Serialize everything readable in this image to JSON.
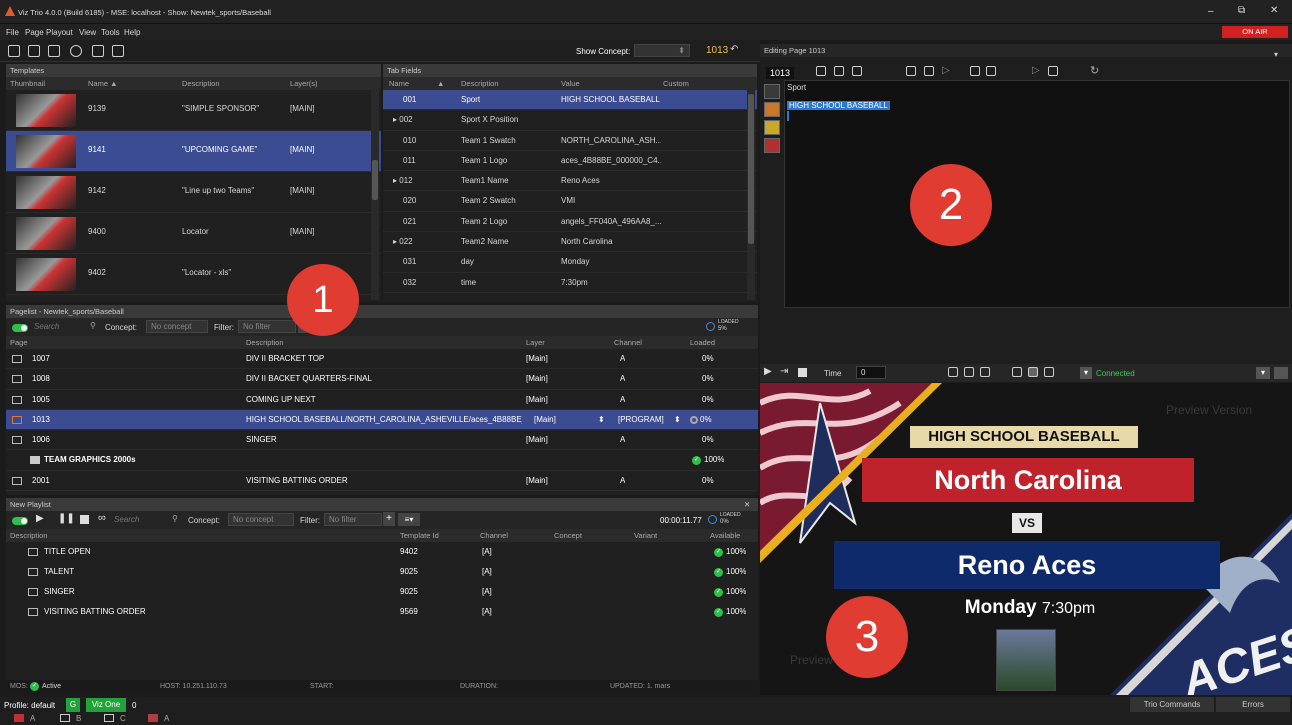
{
  "window": {
    "title": "Viz Trio 4.0.0 (Build 6185) - MSE: localhost - Show: Newtek_sports/Baseball",
    "minimize": "–",
    "restore": "⧉",
    "close": "✕",
    "on_air": "ON AIR"
  },
  "menu": [
    "File",
    "Page",
    "Playout",
    "View",
    "Tools",
    "Help"
  ],
  "toolbar": {
    "show_concept_label": "Show Concept:",
    "page_number": "1013",
    "concept_arrow": "⬍"
  },
  "templates": {
    "header": "Templates",
    "columns": [
      "Thumbnail",
      "Name ▲",
      "Description",
      "Layer(s)"
    ],
    "rows": [
      {
        "name": "9139",
        "description": "\"SIMPLE SPONSOR\"",
        "layer": "[MAIN]"
      },
      {
        "name": "9141",
        "description": "\"UPCOMING GAME\"",
        "layer": "[MAIN]"
      },
      {
        "name": "9142",
        "description": "\"Line up two Teams\"",
        "layer": "[MAIN]"
      },
      {
        "name": "9400",
        "description": "Locator",
        "layer": "[MAIN]"
      },
      {
        "name": "9402",
        "description": "\"Locator - xls\"",
        "layer": ""
      }
    ]
  },
  "tab_fields": {
    "header": "Tab Fields",
    "columns": [
      "Name",
      "▲",
      "Description",
      "Value",
      "Custom"
    ],
    "rows": [
      {
        "name": "001",
        "description": "Sport",
        "value": "HIGH SCHOOL BASEBALL"
      },
      {
        "name": "▸ 002",
        "description": "Sport X Position",
        "value": ""
      },
      {
        "name": "010",
        "description": "Team 1 Swatch",
        "value": "NORTH_CAROLINA_ASH..."
      },
      {
        "name": "011",
        "description": "Team 1 Logo",
        "value": "aces_4B88BE_000000_C4..."
      },
      {
        "name": "▸ 012",
        "description": "Team1 Name",
        "value": "Reno Aces"
      },
      {
        "name": "020",
        "description": "Team 2 Swatch",
        "value": "VMI"
      },
      {
        "name": "021",
        "description": "Team 2 Logo",
        "value": "angels_FF040A_496AA8_..."
      },
      {
        "name": "▸ 022",
        "description": "Team2 Name",
        "value": "North Carolina"
      },
      {
        "name": "031",
        "description": "day",
        "value": "Monday"
      },
      {
        "name": "032",
        "description": "time",
        "value": "7:30pm"
      }
    ]
  },
  "editing": {
    "header": "Editing Page 1013",
    "page_number": "1013",
    "field_label": "Sport",
    "field_value": "HIGH SCHOOL BASEBALL",
    "side_icons": [
      "ABC",
      "TXT",
      "IMG",
      "CLR"
    ]
  },
  "pagelist": {
    "header": "Pagelist - Newtek_sports/Baseball",
    "search_placeholder": "Search",
    "concept_label": "Concept:",
    "concept_value": "No concept",
    "filter_label": "Filter:",
    "filter_value": "No filter",
    "add": "+",
    "loaded_badge": "LOADED",
    "loaded_pct": "5%",
    "columns": [
      "Page",
      "Description",
      "Layer",
      "Channel",
      "Loaded"
    ],
    "rows": [
      {
        "page": "1007",
        "description": "DIV II BRACKET TOP",
        "layer": "[Main]",
        "channel": "A",
        "loaded": "0%",
        "folder": false
      },
      {
        "page": "1008",
        "description": "DIV II BACKET QUARTERS-FINAL",
        "layer": "[Main]",
        "channel": "A",
        "loaded": "0%",
        "folder": false
      },
      {
        "page": "1005",
        "description": "COMING UP NEXT",
        "layer": "[Main]",
        "channel": "A",
        "loaded": "0%",
        "folder": false
      },
      {
        "page": "1013",
        "description": "HIGH SCHOOL BASEBALL/NORTH_CAROLINA_ASHEVILLE/aces_4B88BE_...",
        "layer": "[Main]",
        "channel": "[PROGRAM]",
        "loaded": "0%",
        "folder": false
      },
      {
        "page": "1006",
        "description": "SINGER",
        "layer": "[Main]",
        "channel": "A",
        "loaded": "0%",
        "folder": false
      },
      {
        "page": "TEAM GRAPHICS 2000s",
        "description": "",
        "layer": "",
        "channel": "",
        "loaded": "100%",
        "folder": true
      },
      {
        "page": "2001",
        "description": "VISITING BATTING ORDER",
        "layer": "[Main]",
        "channel": "A",
        "loaded": "0%",
        "folder": false
      }
    ]
  },
  "playlist": {
    "header": "New Playlist",
    "close": "✕",
    "search_placeholder": "Search",
    "concept_label": "Concept:",
    "concept_value": "No concept",
    "filter_label": "Filter:",
    "filter_value": "No filter",
    "timer": "00:00:11.77",
    "loaded_badge": "LOADED",
    "loaded_pct": "0%",
    "columns": [
      "Description",
      "Template Id",
      "Channel",
      "Concept",
      "Variant",
      "Available"
    ],
    "rows": [
      {
        "description": "TITLE OPEN",
        "template_id": "9402",
        "channel": "[A]",
        "available": "100%"
      },
      {
        "description": "TALENT",
        "template_id": "9025",
        "channel": "[A]",
        "available": "100%"
      },
      {
        "description": "SINGER",
        "template_id": "9025",
        "channel": "[A]",
        "available": "100%"
      },
      {
        "description": "VISITING BATTING ORDER",
        "template_id": "9569",
        "channel": "[A]",
        "available": "100%"
      }
    ],
    "status": {
      "mos": "MOS:",
      "mos_state": "Active",
      "host": "HOST: 10.251.110.73",
      "start": "START:",
      "duration": "DURATION:",
      "updated": "UPDATED: 1. mars"
    }
  },
  "preview": {
    "time_label": "Time",
    "time_value": "0",
    "connected": "Connected",
    "watermark": "Preview Version",
    "watermark2": "Preview V",
    "banner": "HIGH SCHOOL BASEBALL",
    "team1": "North Carolina",
    "vs": "VS",
    "team2": "Reno Aces",
    "day": "Monday",
    "time": "7:30pm",
    "logo_text": "ACES"
  },
  "markers": [
    "1",
    "2",
    "3"
  ],
  "statusbar": {
    "profile": "Profile: default",
    "g": "G",
    "viz_one": "Viz One",
    "count": "0",
    "trio_commands": "Trio Commands",
    "errors": "Errors",
    "channels": [
      "A",
      "B",
      "C",
      "A"
    ]
  },
  "colors": {
    "selection": "#3c4c92",
    "accent": "#e03c31",
    "green": "#2fbf4a",
    "preview_red": "#c0222c",
    "preview_blue": "#0f2a6b"
  }
}
